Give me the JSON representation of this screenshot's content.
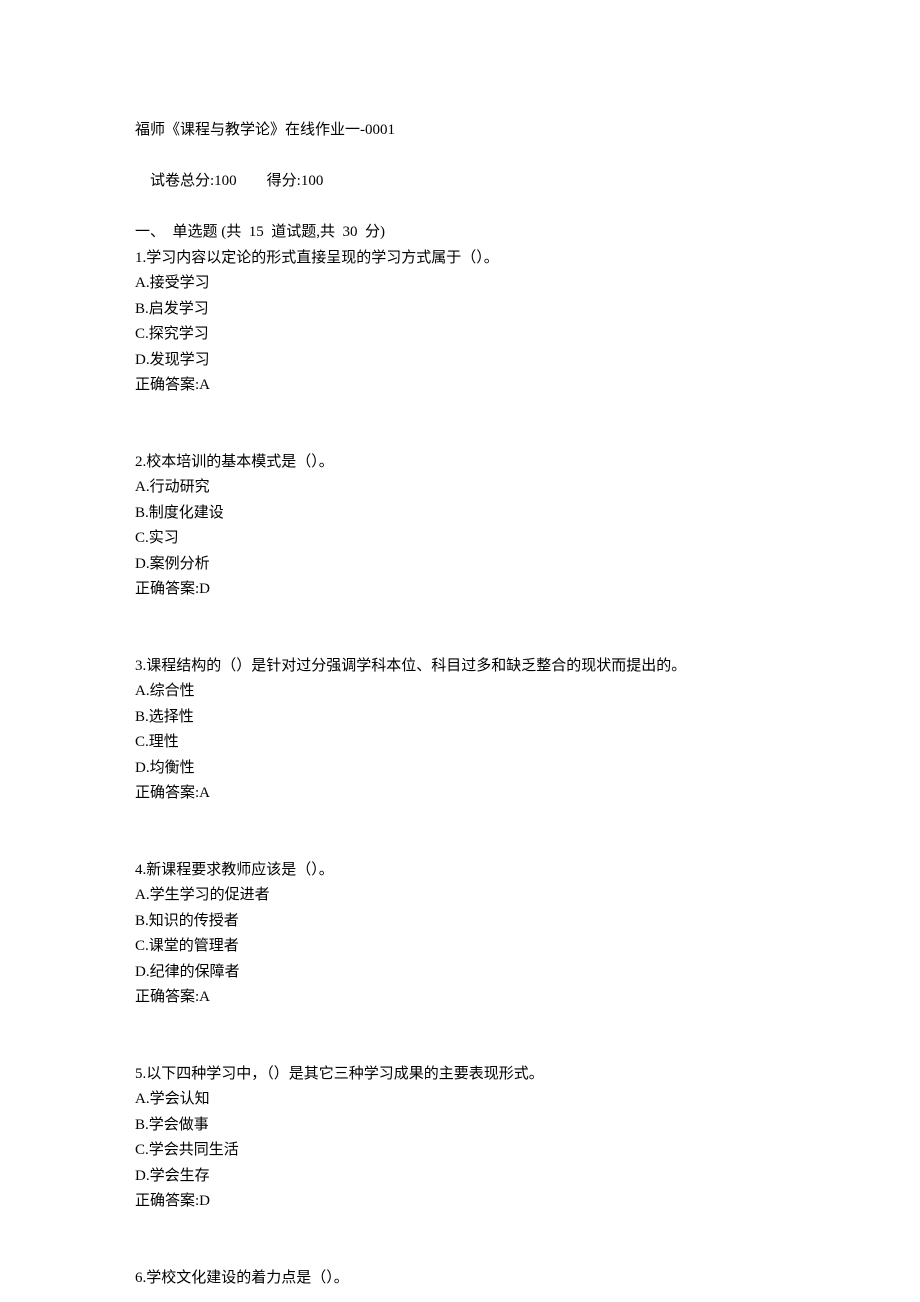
{
  "header": {
    "title_line": "福师《课程与教学论》在线作业一-0001",
    "score_line_prefix": "试卷总分:",
    "score_total": "100",
    "score_line_mid": "        得分:",
    "score_obtained": "100",
    "section_line": "一、  单选题 (共  15  道试题,共  30  分)"
  },
  "questions": [
    {
      "stem": "1.学习内容以定论的形式直接呈现的学习方式属于（）。",
      "options": [
        "A.接受学习",
        "B.启发学习",
        "C.探究学习",
        "D.发现学习"
      ],
      "answer_label": "正确答案:",
      "answer_value": "A"
    },
    {
      "stem": "2.校本培训的基本模式是（）。",
      "options": [
        "A.行动研究",
        "B.制度化建设",
        "C.实习",
        "D.案例分析"
      ],
      "answer_label": "正确答案:",
      "answer_value": "D"
    },
    {
      "stem": "3.课程结构的（）是针对过分强调学科本位、科目过多和缺乏整合的现状而提出的。",
      "options": [
        "A.综合性",
        "B.选择性",
        "C.理性",
        "D.均衡性"
      ],
      "answer_label": "正确答案:",
      "answer_value": "A"
    },
    {
      "stem": "4.新课程要求教师应该是（）。",
      "options": [
        "A.学生学习的促进者",
        "B.知识的传授者",
        "C.课堂的管理者",
        "D.纪律的保障者"
      ],
      "answer_label": "正确答案:",
      "answer_value": "A"
    },
    {
      "stem": "5.以下四种学习中，（）是其它三种学习成果的主要表现形式。",
      "options": [
        "A.学会认知",
        "B.学会做事",
        "C.学会共同生活",
        "D.学会生存"
      ],
      "answer_label": "正确答案:",
      "answer_value": "D"
    },
    {
      "stem": "6.学校文化建设的着力点是（）。",
      "options": [],
      "answer_label": "",
      "answer_value": ""
    }
  ]
}
